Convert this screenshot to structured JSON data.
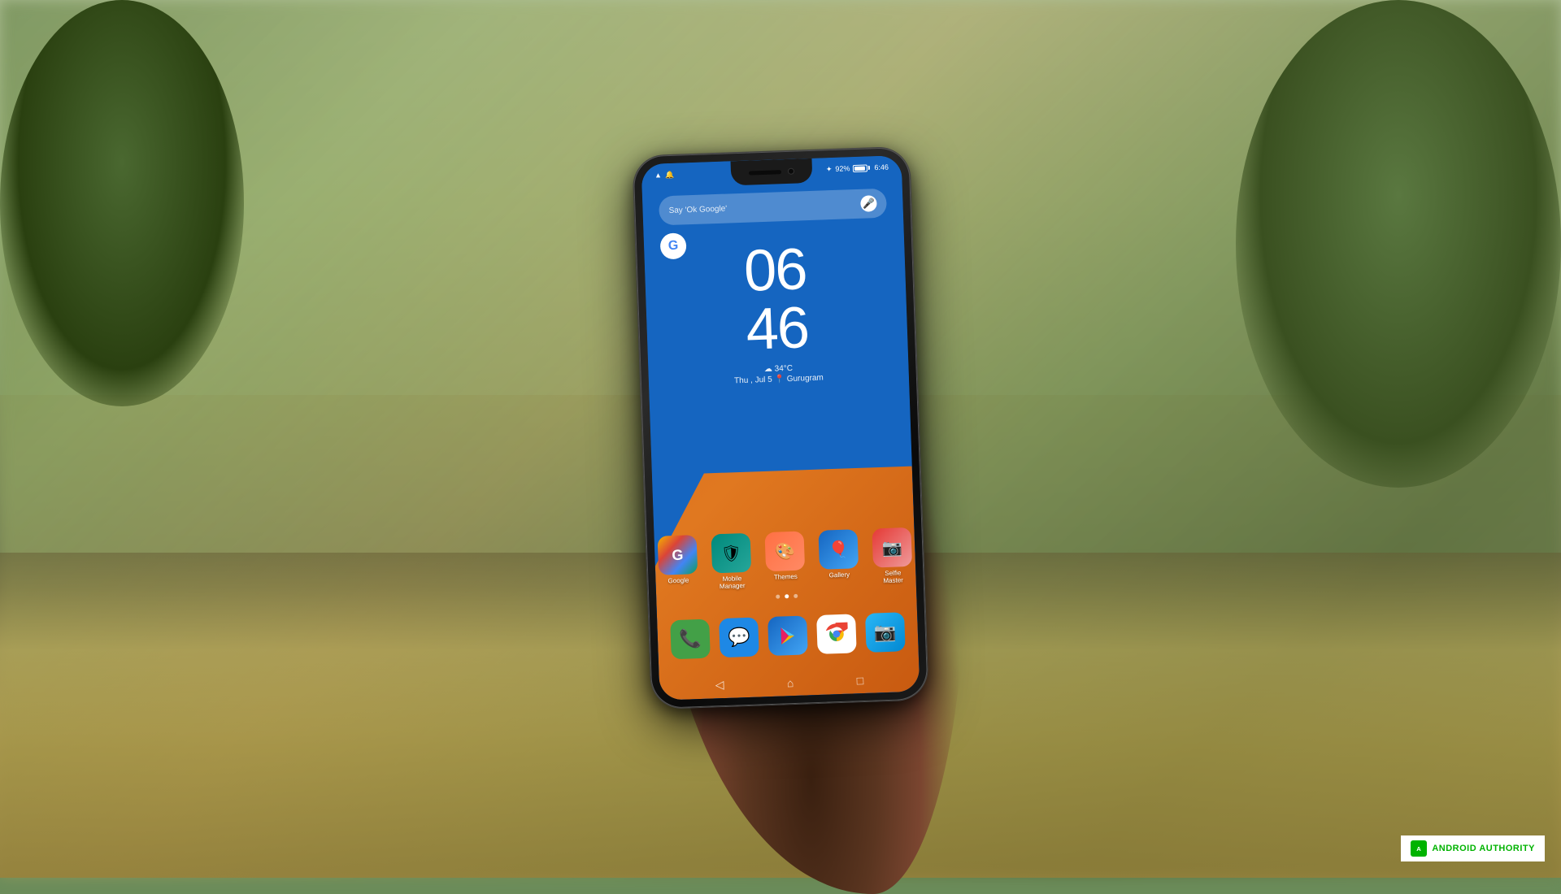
{
  "background": {
    "colors": {
      "sky": "#c8d8b0",
      "ground": "#8a9a60",
      "road": "#d4c080"
    }
  },
  "phone": {
    "status_bar": {
      "time": "6:46",
      "battery_percent": "92%",
      "wifi_icon": "wifi",
      "notification_icon": "bell",
      "bluetooth_icon": "bluetooth"
    },
    "search_bar": {
      "placeholder": "Say 'Ok Google'",
      "mic_hint": "microphone"
    },
    "clock": {
      "hour": "06",
      "minute": "46",
      "weather": "34°C",
      "date": "Thu , Jul 5",
      "location": "Gurugram",
      "weather_icon": "cloud"
    },
    "apps": [
      {
        "name": "Google",
        "icon_type": "google",
        "label": "Google"
      },
      {
        "name": "Mobile Manager",
        "icon_type": "mobile-manager",
        "label": "Mobile\nManager"
      },
      {
        "name": "Themes",
        "icon_type": "themes",
        "label": "Themes"
      },
      {
        "name": "Gallery",
        "icon_type": "gallery",
        "label": "Gallery"
      },
      {
        "name": "Selfie Master",
        "icon_type": "selfie",
        "label": "Selfie\nMaster"
      }
    ],
    "dock": [
      {
        "name": "Phone",
        "icon_type": "phone"
      },
      {
        "name": "Messages",
        "icon_type": "messages"
      },
      {
        "name": "Play Store",
        "icon_type": "play"
      },
      {
        "name": "Chrome",
        "icon_type": "chrome"
      },
      {
        "name": "Camera",
        "icon_type": "camera"
      }
    ],
    "page_dots": 3,
    "active_dot": 1
  },
  "watermark": {
    "brand": "ANDROID",
    "brand_highlight": "AUTHORITY"
  }
}
